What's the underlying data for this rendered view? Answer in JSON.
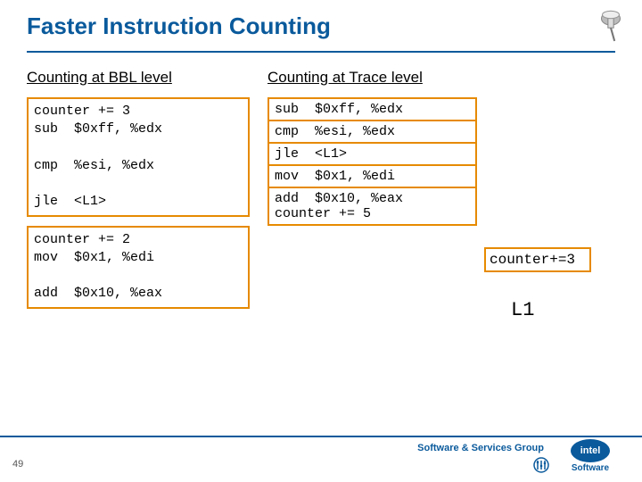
{
  "title": "Faster Instruction Counting",
  "left": {
    "heading": "Counting at BBL level",
    "blocks": [
      "counter += 3\nsub  $0xff, %edx\n\ncmp  %esi, %edx\n\njle  <L1>",
      "counter += 2\nmov  $0x1, %edi\n\nadd  $0x10, %eax"
    ]
  },
  "right": {
    "heading": "Counting at Trace level",
    "rows": [
      "sub  $0xff, %edx",
      "cmp  %esi, %edx",
      "jle  <L1>",
      "mov  $0x1, %edi",
      "add  $0x10, %eax\ncounter += 5"
    ]
  },
  "side": {
    "box": "counter+=3",
    "label": "L1"
  },
  "footer": {
    "group": "Software & Services Group",
    "brand": "intel",
    "sub": "Software",
    "page": "49"
  }
}
